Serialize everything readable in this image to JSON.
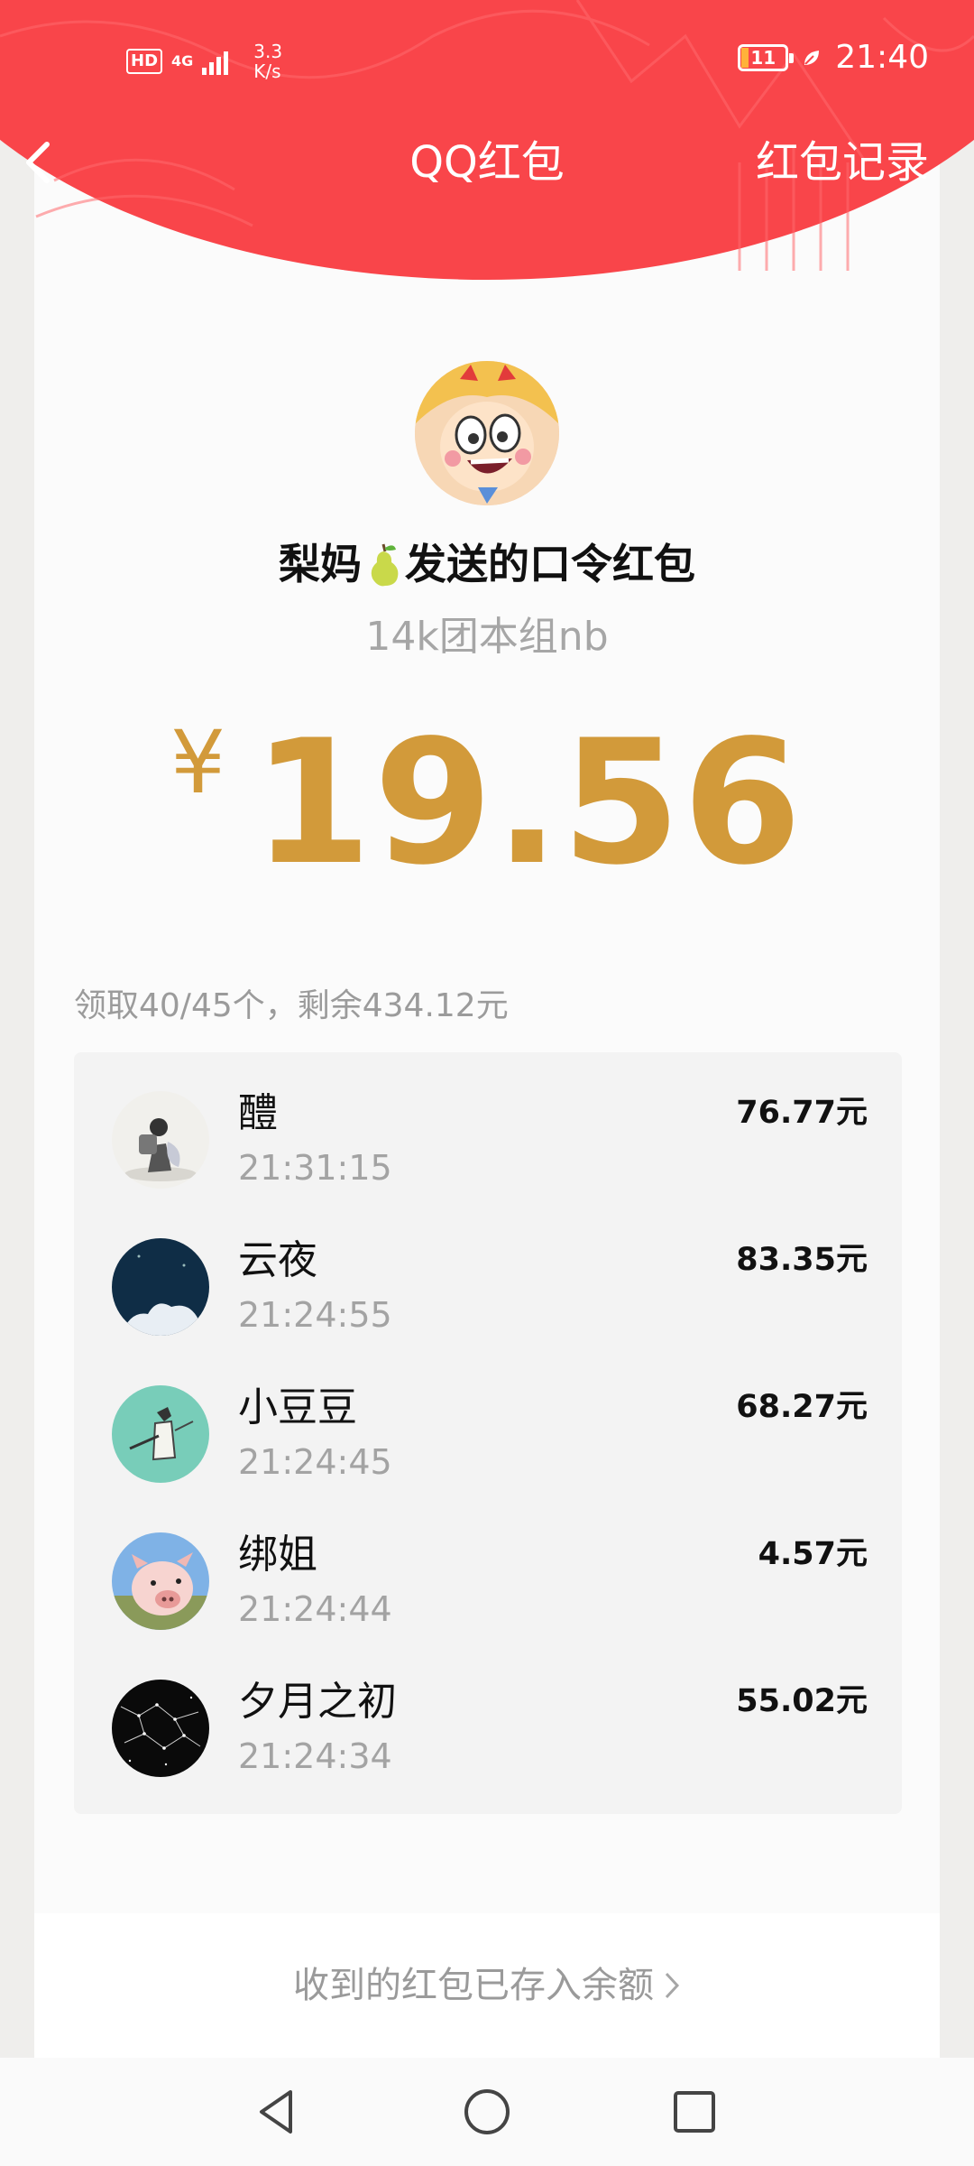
{
  "status_bar": {
    "hd": "HD",
    "network": "4G",
    "speed_value": "3.3",
    "speed_unit": "K/s",
    "battery": "11",
    "time": "21:40"
  },
  "nav": {
    "title": "QQ红包",
    "record": "红包记录"
  },
  "packet": {
    "sender_name": "梨妈",
    "sender_suffix": "发送的口令红包",
    "password": "14k团本组nb",
    "currency": "¥",
    "amount": "19.56"
  },
  "summary": "领取40/45个，剩余434.12元",
  "recipients": [
    {
      "name": "醴",
      "time": "21:31:15",
      "amount": "76.77元"
    },
    {
      "name": "云夜",
      "time": "21:24:55",
      "amount": "83.35元"
    },
    {
      "name": "小豆豆",
      "time": "21:24:45",
      "amount": "68.27元"
    },
    {
      "name": "绑姐",
      "time": "21:24:44",
      "amount": "4.57元"
    },
    {
      "name": "夕月之初",
      "time": "21:24:34",
      "amount": "55.02元"
    }
  ],
  "footer": {
    "link": "收到的红包已存入余额"
  },
  "colors": {
    "header_red": "#f9454a",
    "amount_gold": "#d29a3a"
  }
}
